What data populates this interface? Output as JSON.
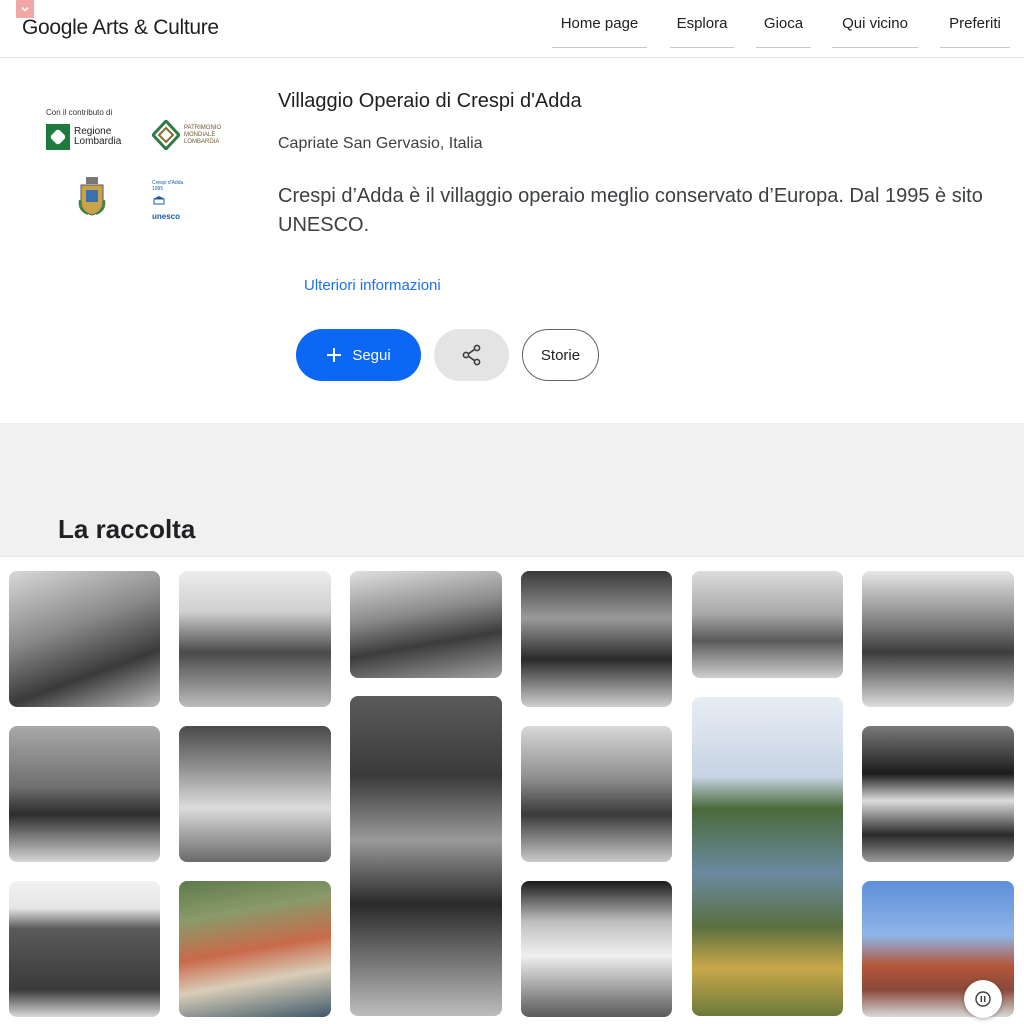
{
  "header": {
    "brand": "Google Arts & Culture",
    "nav": [
      "Home page",
      "Esplora",
      "Gioca",
      "Qui vicino",
      "Preferiti"
    ]
  },
  "partners": {
    "contribution_label": "Con il contributo di",
    "regione_logo_text": "Regione\nLombardia",
    "patrimonio_logo_text": "PATRIMONIO MONDIALE LOMBARDIA",
    "unesco_text": "Crespi d'Adda 1995",
    "unesco_word": "unesco"
  },
  "entity": {
    "title": "Villaggio Operaio di Crespi d'Adda",
    "location": "Capriate San Gervasio, Italia",
    "description": "Crespi d’Adda è il villaggio operaio meglio conservato d’Europa. Dal 1995 è sito UNESCO.",
    "more_link": "Ulteriori informazioni"
  },
  "actions": {
    "follow_label": "Segui",
    "stories_label": "Storie"
  },
  "collection": {
    "title": "La raccolta"
  },
  "colors": {
    "accent": "#0b67f4",
    "link": "#1a73e8"
  }
}
